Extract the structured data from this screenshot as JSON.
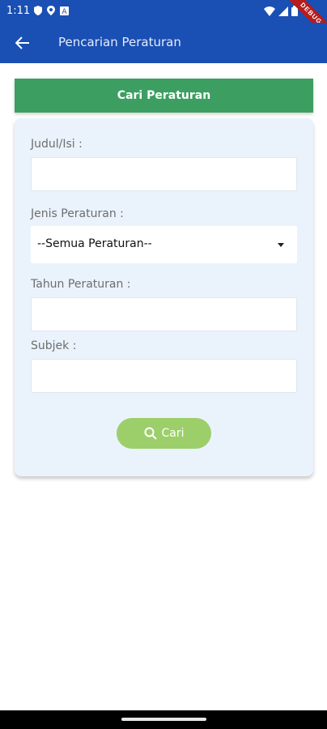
{
  "status_bar": {
    "time": "1:11",
    "debug_label": "DEBUG"
  },
  "app_bar": {
    "title": "Pencarian Peraturan",
    "back_icon": "arrow-back-icon"
  },
  "card": {
    "header": "Cari Peraturan",
    "fields": [
      {
        "label": "Judul/Isi :",
        "value": ""
      },
      {
        "label": "Jenis Peraturan :",
        "selected": "--Semua Peraturan--"
      },
      {
        "label": "Tahun Peraturan :",
        "value": ""
      },
      {
        "label": "Subjek :",
        "value": ""
      }
    ],
    "search_button": "Cari"
  },
  "colors": {
    "app_bar": "#1a4fb3",
    "card_header": "#3d9e62",
    "card_bg": "#eaf3fc",
    "search_button": "#9ccf6a"
  }
}
